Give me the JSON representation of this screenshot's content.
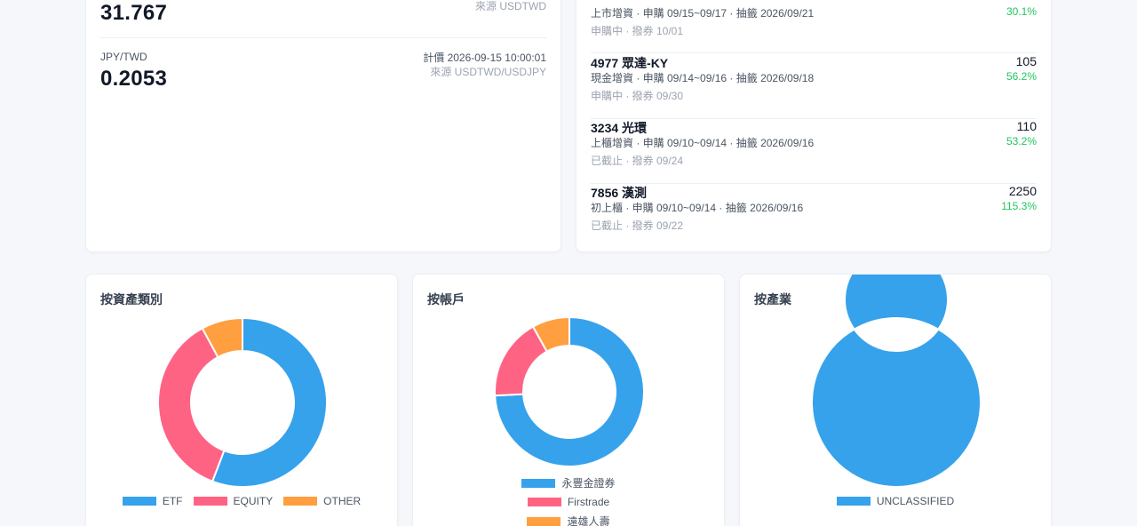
{
  "fx": {
    "top": {
      "value": "31.767",
      "source": "來源 USDTWD"
    },
    "jpy": {
      "pair": "JPY/TWD",
      "value": "0.2053",
      "time": "計價 2026-09-15 10:00:01",
      "source": "來源 USDTWD/USDJPY"
    }
  },
  "ipo": {
    "items": [
      {
        "name": "",
        "detail": "上市增資 · 申購 09/15~09/17 · 抽籤 2026/09/21",
        "status": "申購中 · 撥券 10/01",
        "price": "",
        "pct": "30.1%"
      },
      {
        "name": "4977 眾達-KY",
        "detail": "現金增資 · 申購 09/14~09/16 · 抽籤 2026/09/18",
        "status": "申購中 · 撥券 09/30",
        "price": "105",
        "pct": "56.2%"
      },
      {
        "name": "3234 光環",
        "detail": "上櫃增資 · 申購 09/10~09/14 · 抽籤 2026/09/16",
        "status": "已截止 · 撥券 09/24",
        "price": "110",
        "pct": "53.2%"
      },
      {
        "name": "7856 漢測",
        "detail": "初上櫃 · 申購 09/10~09/14 · 抽籤 2026/09/16",
        "status": "已截止 · 撥券 09/22",
        "price": "2250",
        "pct": "115.3%"
      }
    ]
  },
  "charts": {
    "asset": {
      "title": "按資產類別",
      "chart_data": {
        "type": "pie",
        "donut": true,
        "categories": [
          "ETF",
          "EQUITY",
          "OTHER"
        ],
        "values": [
          55.8,
          36.3,
          7.9
        ],
        "colors": [
          "#36a2eb",
          "#ff6384",
          "#ff9f40"
        ],
        "legend": "bottom"
      }
    },
    "account": {
      "title": "按帳戶",
      "chart_data": {
        "type": "pie",
        "donut": true,
        "categories": [
          "永豐金證券",
          "Firstrade",
          "遠雄人壽"
        ],
        "values": [
          74.2,
          17.7,
          8.1
        ],
        "colors": [
          "#36a2eb",
          "#ff6384",
          "#ff9f40"
        ],
        "legend": "bottom"
      }
    },
    "industry": {
      "title": "按產業",
      "chart_data": {
        "type": "pie",
        "donut": true,
        "categories": [
          "UNCLASSIFIED"
        ],
        "values": [
          100
        ],
        "colors": [
          "#36a2eb"
        ],
        "legend": "bottom"
      }
    }
  }
}
